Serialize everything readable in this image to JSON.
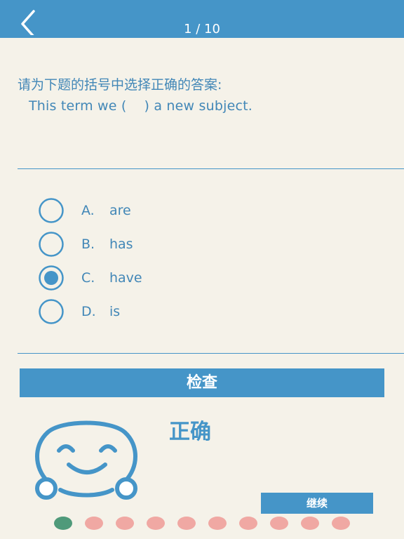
{
  "header": {
    "progress": "1 / 10",
    "current_question": 1,
    "total_questions": 10
  },
  "question": {
    "prompt": "请为下题的括号中选择正确的答案:",
    "sentence": "This term we (    ) a new subject."
  },
  "options": [
    {
      "letter": "A.",
      "text": "are",
      "selected": false
    },
    {
      "letter": "B.",
      "text": "has",
      "selected": false
    },
    {
      "letter": "C.",
      "text": "have",
      "selected": true
    },
    {
      "letter": "D.",
      "text": "is",
      "selected": false
    }
  ],
  "check_button": {
    "label": "检查"
  },
  "result": {
    "label": "正确",
    "icon": "smiley-face-icon"
  },
  "continue_button": {
    "label": "继续"
  },
  "progress_dots": [
    {
      "state": "correct"
    },
    {
      "state": "pending"
    },
    {
      "state": "pending"
    },
    {
      "state": "pending"
    },
    {
      "state": "pending"
    },
    {
      "state": "pending"
    },
    {
      "state": "pending"
    },
    {
      "state": "pending"
    },
    {
      "state": "pending"
    },
    {
      "state": "pending"
    }
  ],
  "colors": {
    "primary": "#4595c8",
    "text": "#4287b7",
    "background": "#f5f2e9",
    "dot_correct": "#4f9a7a",
    "dot_pending": "#f0a8a3"
  }
}
